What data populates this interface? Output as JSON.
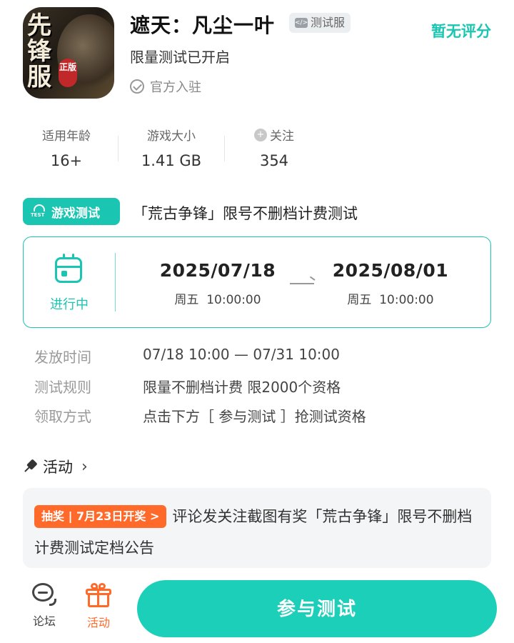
{
  "app": {
    "icon_text": "先锋服",
    "icon_seal": "正版",
    "title": "遮天：凡尘一叶",
    "test_badge": "测试服",
    "rating": "暂无评分",
    "subtitle": "限量测试已开启",
    "official": "官方入驻"
  },
  "stats": {
    "age_label": "适用年龄",
    "age_value": "16+",
    "size_label": "游戏大小",
    "size_value": "1.41 GB",
    "follow_label": "关注",
    "follow_value": "354"
  },
  "test": {
    "tag": "游戏测试",
    "tag_icon_text": "TEST",
    "name": "「荒古争锋」限号不删档计费测试",
    "status": "进行中",
    "start_date": "2025/07/18",
    "start_time": "周五  10:00:00",
    "end_date": "2025/08/01",
    "end_time": "周五  10:00:00"
  },
  "info": [
    {
      "key": "发放时间",
      "value": "07/18 10:00 — 07/31 10:00"
    },
    {
      "key": "测试规则",
      "value": "限量不删档计费 限2000个资格"
    },
    {
      "key": "领取方式",
      "value": "点击下方［ 参与测试 ］抢测试资格"
    }
  ],
  "activity": {
    "heading": "活动",
    "tag": "抽奖 | 7月23日开奖 >",
    "text": "评论发关注截图有奖「荒古争锋」限号不删档计费测试定档公告"
  },
  "bottom": {
    "forum_label": "论坛",
    "activity_label": "活动",
    "join_label": "参与测试"
  },
  "colors": {
    "accent": "#1ac5b1",
    "orange": "#ff6a2b"
  }
}
